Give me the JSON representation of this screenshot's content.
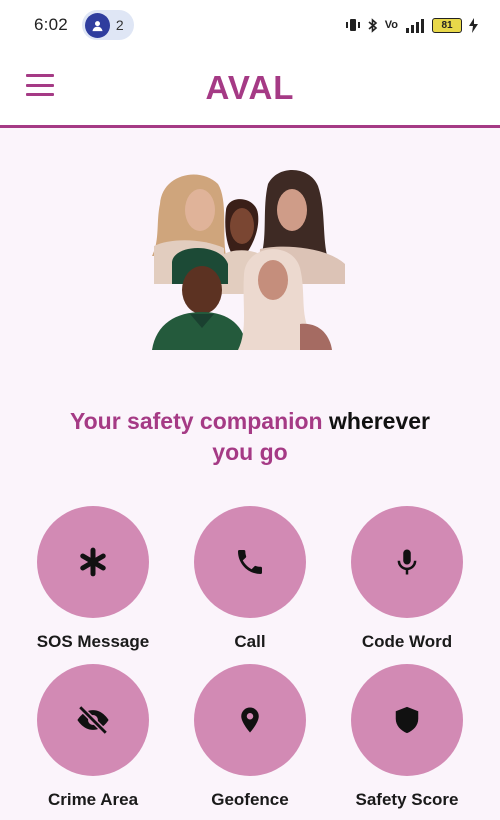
{
  "status_bar": {
    "time": "6:02",
    "hotspot_count": "2",
    "battery": "81"
  },
  "app_bar": {
    "title": "AVAL",
    "menu_icon": "hamburger-menu-icon"
  },
  "tagline": {
    "highlight": "Your safety companion",
    "normal": "wherever",
    "end": "you go"
  },
  "features": [
    {
      "label": "SOS Message",
      "icon": "asterisk-icon"
    },
    {
      "label": "Call",
      "icon": "phone-icon"
    },
    {
      "label": "Code Word",
      "icon": "microphone-icon"
    },
    {
      "label": "Crime Area",
      "icon": "eye-off-icon"
    },
    {
      "label": "Geofence",
      "icon": "location-pin-icon"
    },
    {
      "label": "Safety Score",
      "icon": "shield-icon"
    }
  ],
  "colors": {
    "brand": "#a53a85",
    "button": "#d28ab4",
    "background": "#fbf4fb"
  }
}
